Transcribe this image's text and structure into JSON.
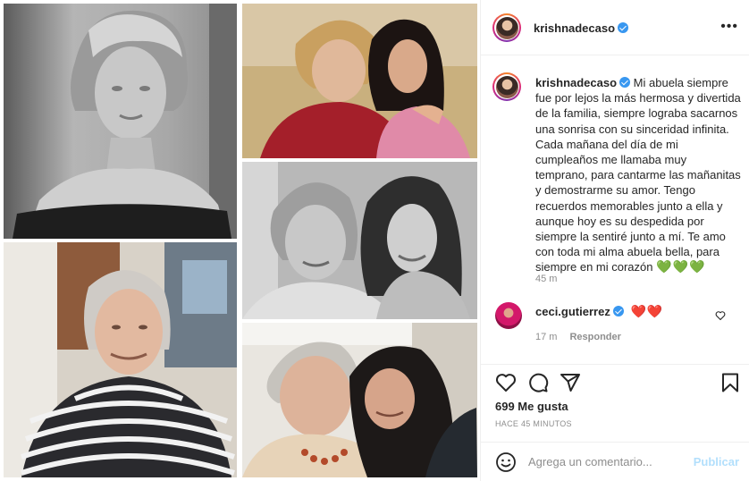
{
  "post": {
    "username": "krishnadecaso",
    "caption": "Mi abuela siempre fue por lejos la más hermosa y divertida de la familia, siempre lograba sacarnos una sonrisa con su sinceridad infinita. Cada mañana del día de mi cumpleaños me llamaba muy temprano, para cantarme las mañanitas y demostrarme su amor. Tengo recuerdos memorables junto a ella y aunque hoy es su despedida por siempre la sentiré junto a mí. Te amo con toda mi alma abuela bella, para siempre en mi corazón",
    "caption_emoji": "💚💚💚",
    "caption_time": "45 m",
    "likes": "699 Me gusta",
    "time_ago": "HACE 45 MINUTOS"
  },
  "comment": {
    "username": "ceci.gutierrez",
    "text_emoji": "❤️❤️",
    "time": "17 m",
    "reply_label": "Responder"
  },
  "composer": {
    "placeholder": "Agrega un comentario...",
    "publish_label": "Publicar"
  },
  "icons": [
    "more-icon",
    "verified-icon",
    "heart-icon",
    "comment-icon",
    "share-icon",
    "bookmark-icon",
    "emoji-icon"
  ],
  "colors": {
    "verified": "#3897f0",
    "publish_disabled": "#b2dffc",
    "muted": "#8e8e8e",
    "text": "#262626"
  }
}
